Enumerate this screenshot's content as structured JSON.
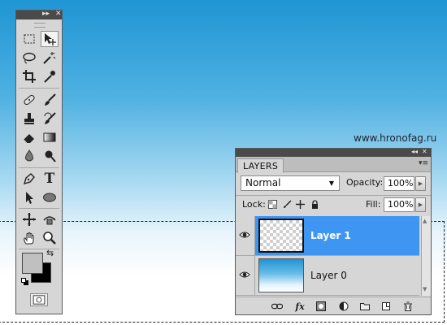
{
  "watermark": "www.hronofag.ru",
  "toolbox": {
    "collapse_glyph": "▸▸",
    "close_glyph": "✕",
    "tools": [
      {
        "name": "marquee-tool",
        "icon": "marquee-icon"
      },
      {
        "name": "move-tool",
        "icon": "move-icon",
        "active": true
      },
      {
        "name": "lasso-tool",
        "icon": "lasso-icon"
      },
      {
        "name": "magic-wand-tool",
        "icon": "magic-wand-icon"
      },
      {
        "name": "crop-tool",
        "icon": "crop-icon"
      },
      {
        "name": "eyedropper-tool",
        "icon": "eyedropper-icon"
      },
      {
        "name": "healing-brush-tool",
        "icon": "bandage-icon"
      },
      {
        "name": "brush-tool",
        "icon": "brush-icon"
      },
      {
        "name": "clone-stamp-tool",
        "icon": "stamp-icon"
      },
      {
        "name": "history-brush-tool",
        "icon": "history-brush-icon"
      },
      {
        "name": "eraser-tool",
        "icon": "eraser-icon"
      },
      {
        "name": "gradient-tool",
        "icon": "gradient-icon"
      },
      {
        "name": "blur-tool",
        "icon": "drop-icon"
      },
      {
        "name": "dodge-tool",
        "icon": "dodge-icon"
      },
      {
        "name": "pen-tool",
        "icon": "pen-icon"
      },
      {
        "name": "type-tool",
        "icon": "type-icon",
        "label": "T"
      },
      {
        "name": "path-selection-tool",
        "icon": "arrow-icon"
      },
      {
        "name": "shape-tool",
        "icon": "ellipse-icon"
      },
      {
        "name": "3d-rotate-tool",
        "icon": "3d-rotate-icon"
      },
      {
        "name": "3d-orbit-tool",
        "icon": "3d-orbit-icon"
      },
      {
        "name": "hand-tool",
        "icon": "hand-icon"
      },
      {
        "name": "zoom-tool",
        "icon": "zoom-icon"
      }
    ],
    "foreground_color": "#c0c0c0",
    "background_color": "#000000"
  },
  "layers_panel": {
    "collapse_glyph": "◂◂",
    "close_glyph": "✕",
    "tab_label": "LAYERS",
    "menu_glyph": "▾≡",
    "blend_mode": "Normal",
    "opacity_label": "Opacity:",
    "opacity_value": "100%",
    "lock_label": "Lock:",
    "fill_label": "Fill:",
    "fill_value": "100%",
    "layers": [
      {
        "name": "Layer 1",
        "selected": true,
        "visible": true,
        "thumb": "transparent"
      },
      {
        "name": "Layer 0",
        "selected": false,
        "visible": true,
        "thumb": "blue-gradient"
      }
    ],
    "bottom_icons": [
      "link-icon",
      "fx-icon",
      "mask-icon",
      "adjustment-icon",
      "group-folder-icon",
      "new-layer-icon",
      "trash-icon"
    ],
    "fx_label": "fx"
  },
  "colors": {
    "selection_blue": "#3f96f2",
    "panel_gray": "#d6d6d6",
    "titlebar_gray": "#4a4a4a"
  }
}
